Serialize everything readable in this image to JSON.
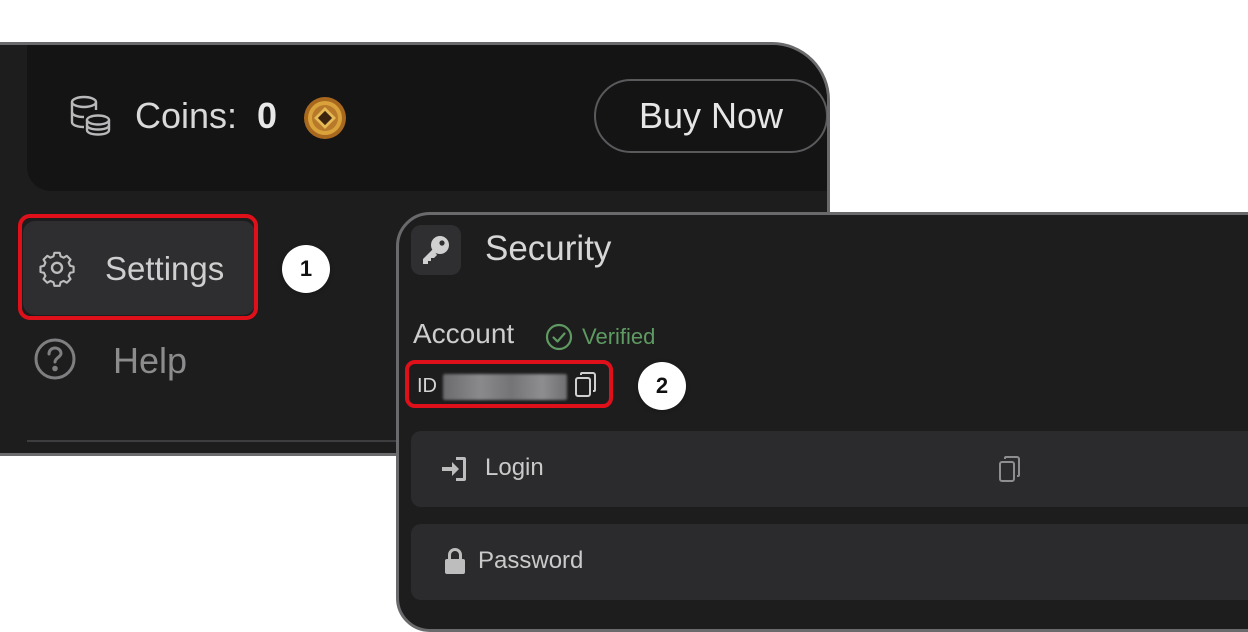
{
  "wallet": {
    "coins_label": "Coins:",
    "coins_value": "0",
    "buy_label": "Buy Now"
  },
  "menu": {
    "settings_label": "Settings",
    "help_label": "Help"
  },
  "security": {
    "title": "Security",
    "account_label": "Account",
    "verified_label": "Verified",
    "id_label": "ID",
    "rows": [
      {
        "label": "Login",
        "icon": "login-icon"
      },
      {
        "label": "Password",
        "icon": "lock-icon"
      }
    ]
  },
  "annotations": {
    "marker_1": "1",
    "marker_2": "2"
  },
  "colors": {
    "highlight": "#e0101a",
    "verified": "#5f9a62",
    "panel_bg": "#1d1d1e",
    "coin_gold": "#c98a2a"
  }
}
